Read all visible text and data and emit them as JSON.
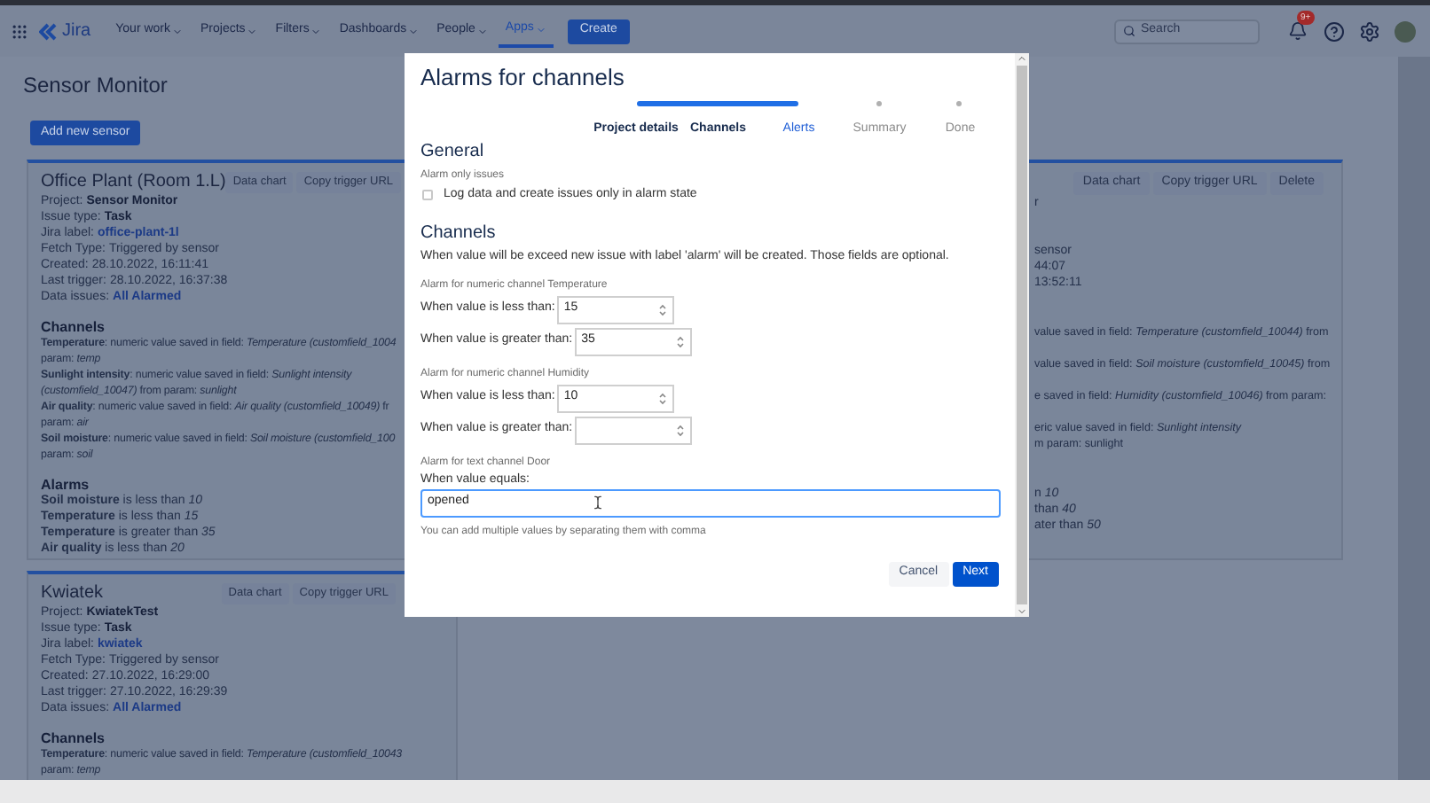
{
  "nav": {
    "logo": "Jira",
    "items": [
      {
        "label": "Your work",
        "selected": false
      },
      {
        "label": "Projects",
        "selected": false
      },
      {
        "label": "Filters",
        "selected": false
      },
      {
        "label": "Dashboards",
        "selected": false
      },
      {
        "label": "People",
        "selected": false
      },
      {
        "label": "Apps",
        "selected": true
      }
    ],
    "create": "Create",
    "search": {
      "placeholder": "Search"
    },
    "badge": "9+"
  },
  "page": {
    "title": "Sensor Monitor",
    "add_button": "Add new sensor"
  },
  "sensors": [
    {
      "name": "Office Plant (Room 1.L)",
      "buttons": [
        "Data chart",
        "Copy trigger URL"
      ],
      "details": [
        {
          "label": "Project:",
          "value": "Sensor Monitor",
          "kind": "bold"
        },
        {
          "label": "Issue type:",
          "value": "Task",
          "kind": "bold"
        },
        {
          "label": "Jira label:",
          "value": "office-plant-1l",
          "kind": "link"
        },
        {
          "label": "Fetch Type:",
          "value": "Triggered by sensor",
          "kind": "plain"
        },
        {
          "label": "Created:",
          "value": "28.10.2022, 16:11:41",
          "kind": "plain"
        },
        {
          "label": "Last trigger:",
          "value": "28.10.2022, 16:37:38",
          "kind": "plain"
        },
        {
          "label": "Data issues:",
          "value": "All Alarmed",
          "kind": "link"
        }
      ],
      "channels_heading": "Channels",
      "channels": [
        "**Temperature**: numeric value saved in field: *Temperature (customfield_1004*",
        "param: *temp*",
        "**Sunlight intensity**: numeric value saved in field: *Sunlight intensity*",
        "*(customfield_10047)* from param: *sunlight*",
        "**Air quality**: numeric value saved in field: *Air quality (customfield_10049)* fr",
        "param: *air*",
        "**Soil moisture**: numeric value saved in field: *Soil moisture (customfield_100*",
        "param: *soil*"
      ],
      "alarms_heading": "Alarms",
      "alarms": [
        "**Soil moisture** is less than *10*",
        "**Temperature** is less than *15*",
        "**Temperature** is greater than *35*",
        "**Air quality** is less than *20*"
      ]
    },
    {
      "name": "Kwiatek",
      "buttons": [
        "Data chart",
        "Copy trigger URL"
      ],
      "details": [
        {
          "label": "Project:",
          "value": "KwiatekTest",
          "kind": "bold"
        },
        {
          "label": "Issue type:",
          "value": "Task",
          "kind": "bold"
        },
        {
          "label": "Jira label:",
          "value": "kwiatek",
          "kind": "link"
        },
        {
          "label": "Fetch Type:",
          "value": "Triggered by sensor",
          "kind": "plain"
        },
        {
          "label": "Created:",
          "value": "27.10.2022, 16:29:00",
          "kind": "plain"
        },
        {
          "label": "Last trigger:",
          "value": "27.10.2022, 16:29:39",
          "kind": "plain"
        },
        {
          "label": "Data issues:",
          "value": "All Alarmed",
          "kind": "link"
        }
      ],
      "channels_heading": "Channels",
      "channels": [
        "**Temperature**: numeric value saved in field: *Temperature (customfield_10043*",
        "param: *temp*"
      ]
    }
  ],
  "right_card": {
    "buttons": [
      "Data chart",
      "Copy trigger URL",
      "Delete"
    ],
    "details_top": [
      "r"
    ],
    "details_bottom": [
      "sensor",
      "44:07",
      "13:52:11"
    ],
    "channels": [
      {
        "lines": [
          "value saved in field: *Temperature (customfield_10044)* from"
        ]
      },
      {
        "lines": [
          "value saved in field: *Soil moisture (customfield_10045)* from"
        ]
      },
      {
        "lines": [
          "e saved in field: *Humidity (customfield_10046)* from param:"
        ]
      },
      {
        "lines": [
          "eric value saved in field: *Sunlight intensity*",
          "m param: sunlight"
        ]
      }
    ],
    "alarms": [
      "n *10*",
      "than *40*",
      "ater than *50*"
    ]
  },
  "modal": {
    "title": "Alarms for channels",
    "steps": [
      {
        "label": "Project details",
        "done": true,
        "selected": false
      },
      {
        "label": "Channels",
        "done": true,
        "selected": false
      },
      {
        "label": "Alerts",
        "done": false,
        "selected": true
      },
      {
        "label": "Summary",
        "done": false,
        "selected": false
      },
      {
        "label": "Done",
        "done": false,
        "selected": false
      }
    ],
    "progress": {
      "level": 0.5
    },
    "general_heading": "General",
    "alarm_only_label": "Alarm only issues",
    "alarm_only": {
      "label": "Log data and create issues only in alarm state",
      "checked": false
    },
    "channels_heading": "Channels",
    "channels_description": "When value will be exceed new issue with label 'alarm' will be created. Those fields are optional.",
    "groups": [
      {
        "title": "Alarm for numeric channel Temperature",
        "kind": "numeric",
        "fields": [
          {
            "label": "When value is less than:",
            "value": "15"
          },
          {
            "label": "When value is greater than:",
            "value": "35"
          }
        ]
      },
      {
        "title": "Alarm for numeric channel Humidity",
        "kind": "numeric",
        "fields": [
          {
            "label": "When value is less than:",
            "value": "10"
          },
          {
            "label": "When value is greater than:"
          }
        ]
      },
      {
        "title": "Alarm for text channel Door",
        "kind": "text",
        "fields": [
          {
            "label": "When value equals:",
            "value": "opened",
            "hint": "You can add multiple values by separating them with comma"
          }
        ]
      }
    ],
    "buttons": [
      {
        "label": "Cancel",
        "kind": "secondary"
      },
      {
        "label": "Next",
        "kind": "primary"
      }
    ]
  }
}
